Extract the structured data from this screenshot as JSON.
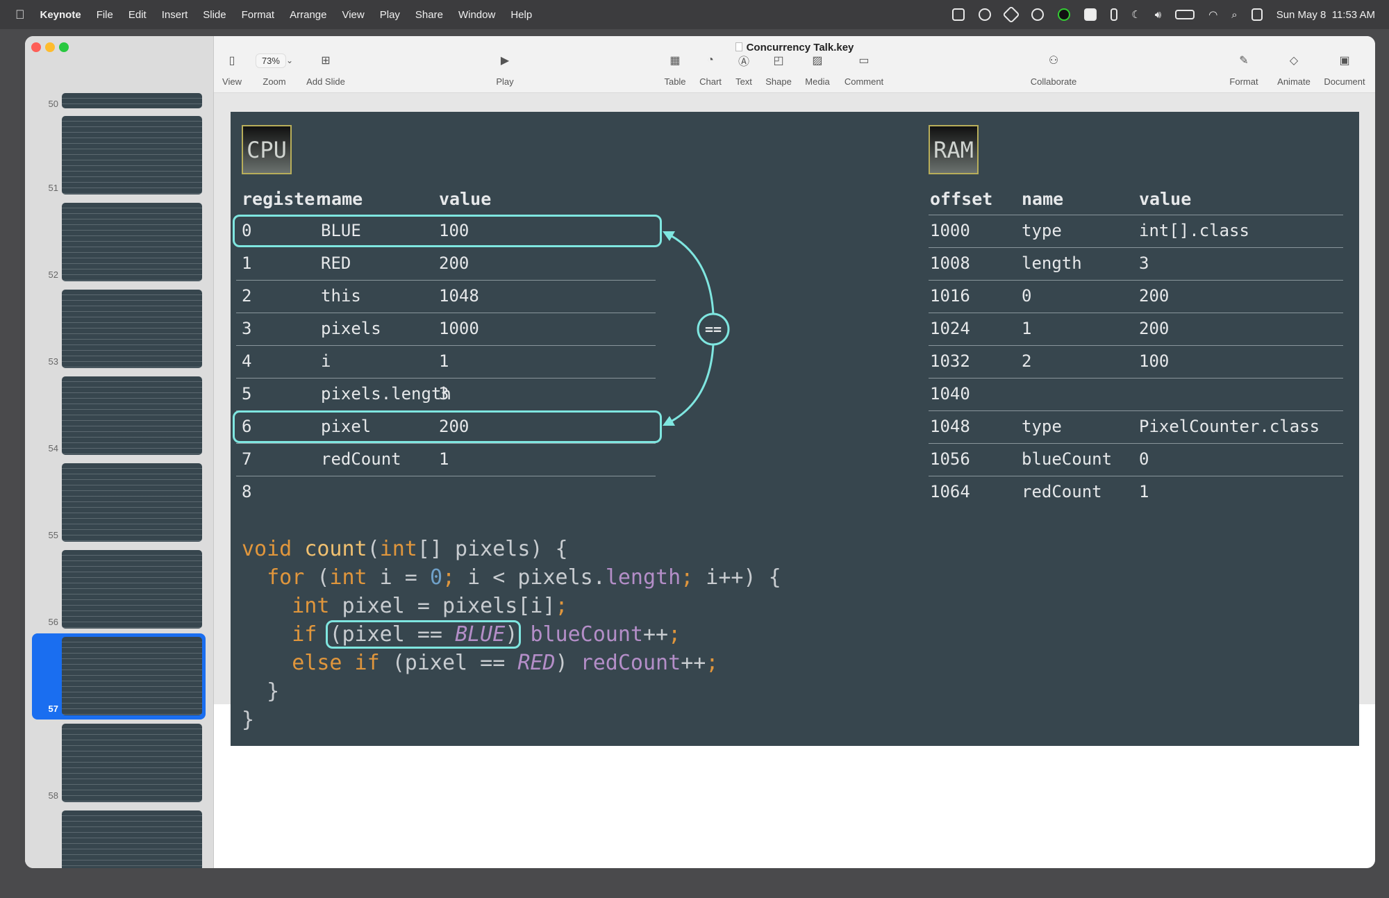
{
  "menubar": {
    "app": "Keynote",
    "items": [
      "File",
      "Edit",
      "Insert",
      "Slide",
      "Format",
      "Arrange",
      "View",
      "Play",
      "Share",
      "Window",
      "Help"
    ],
    "datetime": "Sun May 8  11:53 AM"
  },
  "window": {
    "title": "Concurrency Talk.key"
  },
  "toolbar": {
    "zoom": "73%",
    "items": [
      {
        "label": "View",
        "icon": "sidebar-icon"
      },
      {
        "label": "Zoom",
        "icon": "zoom-select"
      },
      {
        "label": "Add Slide",
        "icon": "add-slide-icon"
      },
      {
        "label": "Play",
        "icon": "play-icon"
      },
      {
        "label": "Table",
        "icon": "table-icon"
      },
      {
        "label": "Chart",
        "icon": "chart-icon"
      },
      {
        "label": "Text",
        "icon": "text-icon"
      },
      {
        "label": "Shape",
        "icon": "shape-icon"
      },
      {
        "label": "Media",
        "icon": "media-icon"
      },
      {
        "label": "Comment",
        "icon": "comment-icon"
      },
      {
        "label": "Collaborate",
        "icon": "collaborate-icon"
      },
      {
        "label": "Format",
        "icon": "format-icon"
      },
      {
        "label": "Animate",
        "icon": "animate-icon"
      },
      {
        "label": "Document",
        "icon": "document-icon"
      }
    ]
  },
  "sidebar": {
    "slides": [
      "50",
      "51",
      "52",
      "53",
      "54",
      "55",
      "56",
      "57",
      "58"
    ],
    "selected": "57"
  },
  "slide": {
    "cpu": {
      "label": "CPU",
      "headers": [
        "register",
        "name",
        "value"
      ],
      "rows": [
        [
          "0",
          "BLUE",
          "100"
        ],
        [
          "1",
          "RED",
          "200"
        ],
        [
          "2",
          "this",
          "1048"
        ],
        [
          "3",
          "pixels",
          "1000"
        ],
        [
          "4",
          "i",
          "1"
        ],
        [
          "5",
          "pixels.length",
          "3"
        ],
        [
          "6",
          "pixel",
          "200"
        ],
        [
          "7",
          "redCount",
          "1"
        ],
        [
          "8",
          "",
          ""
        ]
      ],
      "highlighted_rows": [
        0,
        6
      ],
      "comparison": "=="
    },
    "ram": {
      "label": "RAM",
      "headers": [
        "offset",
        "name",
        "value"
      ],
      "rows": [
        [
          "1000",
          "type",
          "int[].class"
        ],
        [
          "1008",
          "length",
          "3"
        ],
        [
          "1016",
          "0",
          "200"
        ],
        [
          "1024",
          "1",
          "200"
        ],
        [
          "1032",
          "2",
          "100"
        ],
        [
          "1040",
          "",
          ""
        ],
        [
          "1048",
          "type",
          "PixelCounter.class"
        ],
        [
          "1056",
          "blueCount",
          "0"
        ],
        [
          "1064",
          "redCount",
          "1"
        ]
      ]
    },
    "code": [
      [
        [
          "void",
          "kw"
        ],
        [
          " ",
          "pl"
        ],
        [
          "count",
          "fn"
        ],
        [
          "(",
          "pl"
        ],
        [
          "int",
          "kw"
        ],
        [
          "[] pixels) {",
          "pl"
        ]
      ],
      [
        [
          "  for",
          "kw"
        ],
        [
          " (",
          "pl"
        ],
        [
          "int",
          "kw"
        ],
        [
          " i = ",
          "pl"
        ],
        [
          "0",
          "num"
        ],
        [
          ";",
          "kw"
        ],
        [
          " i < pixels.",
          "pl"
        ],
        [
          "length",
          "pu"
        ],
        [
          ";",
          "kw"
        ],
        [
          " i++) {",
          "pl"
        ]
      ],
      [
        [
          "    int",
          "kw"
        ],
        [
          " pixel = pixels[i]",
          "pl"
        ],
        [
          ";",
          "kw"
        ]
      ],
      [
        [
          "    if",
          "kw"
        ],
        [
          " ",
          "pl"
        ],
        [
          "(pixel == |BLUE|)",
          "hl"
        ],
        [
          " ",
          "pl"
        ],
        [
          "blueCount",
          "pu"
        ],
        [
          "++",
          "pl"
        ],
        [
          ";",
          "kw"
        ]
      ],
      [
        [
          "    else if",
          "kw"
        ],
        [
          " (pixel == ",
          "pl"
        ],
        [
          "RED",
          "it"
        ],
        [
          ") ",
          "pl"
        ],
        [
          "redCount",
          "pu"
        ],
        [
          "++",
          "pl"
        ],
        [
          ";",
          "kw"
        ]
      ],
      [
        [
          "  }",
          "pl"
        ]
      ],
      [
        [
          "}",
          "pl"
        ]
      ]
    ]
  },
  "colors": {
    "slide_bg": "#37464e",
    "highlight": "#7fe6e0",
    "keyword": "#e0963c",
    "function": "#f0c070",
    "member": "#b48ec8",
    "number": "#6fa0c8",
    "selection": "#1a6ef0"
  }
}
